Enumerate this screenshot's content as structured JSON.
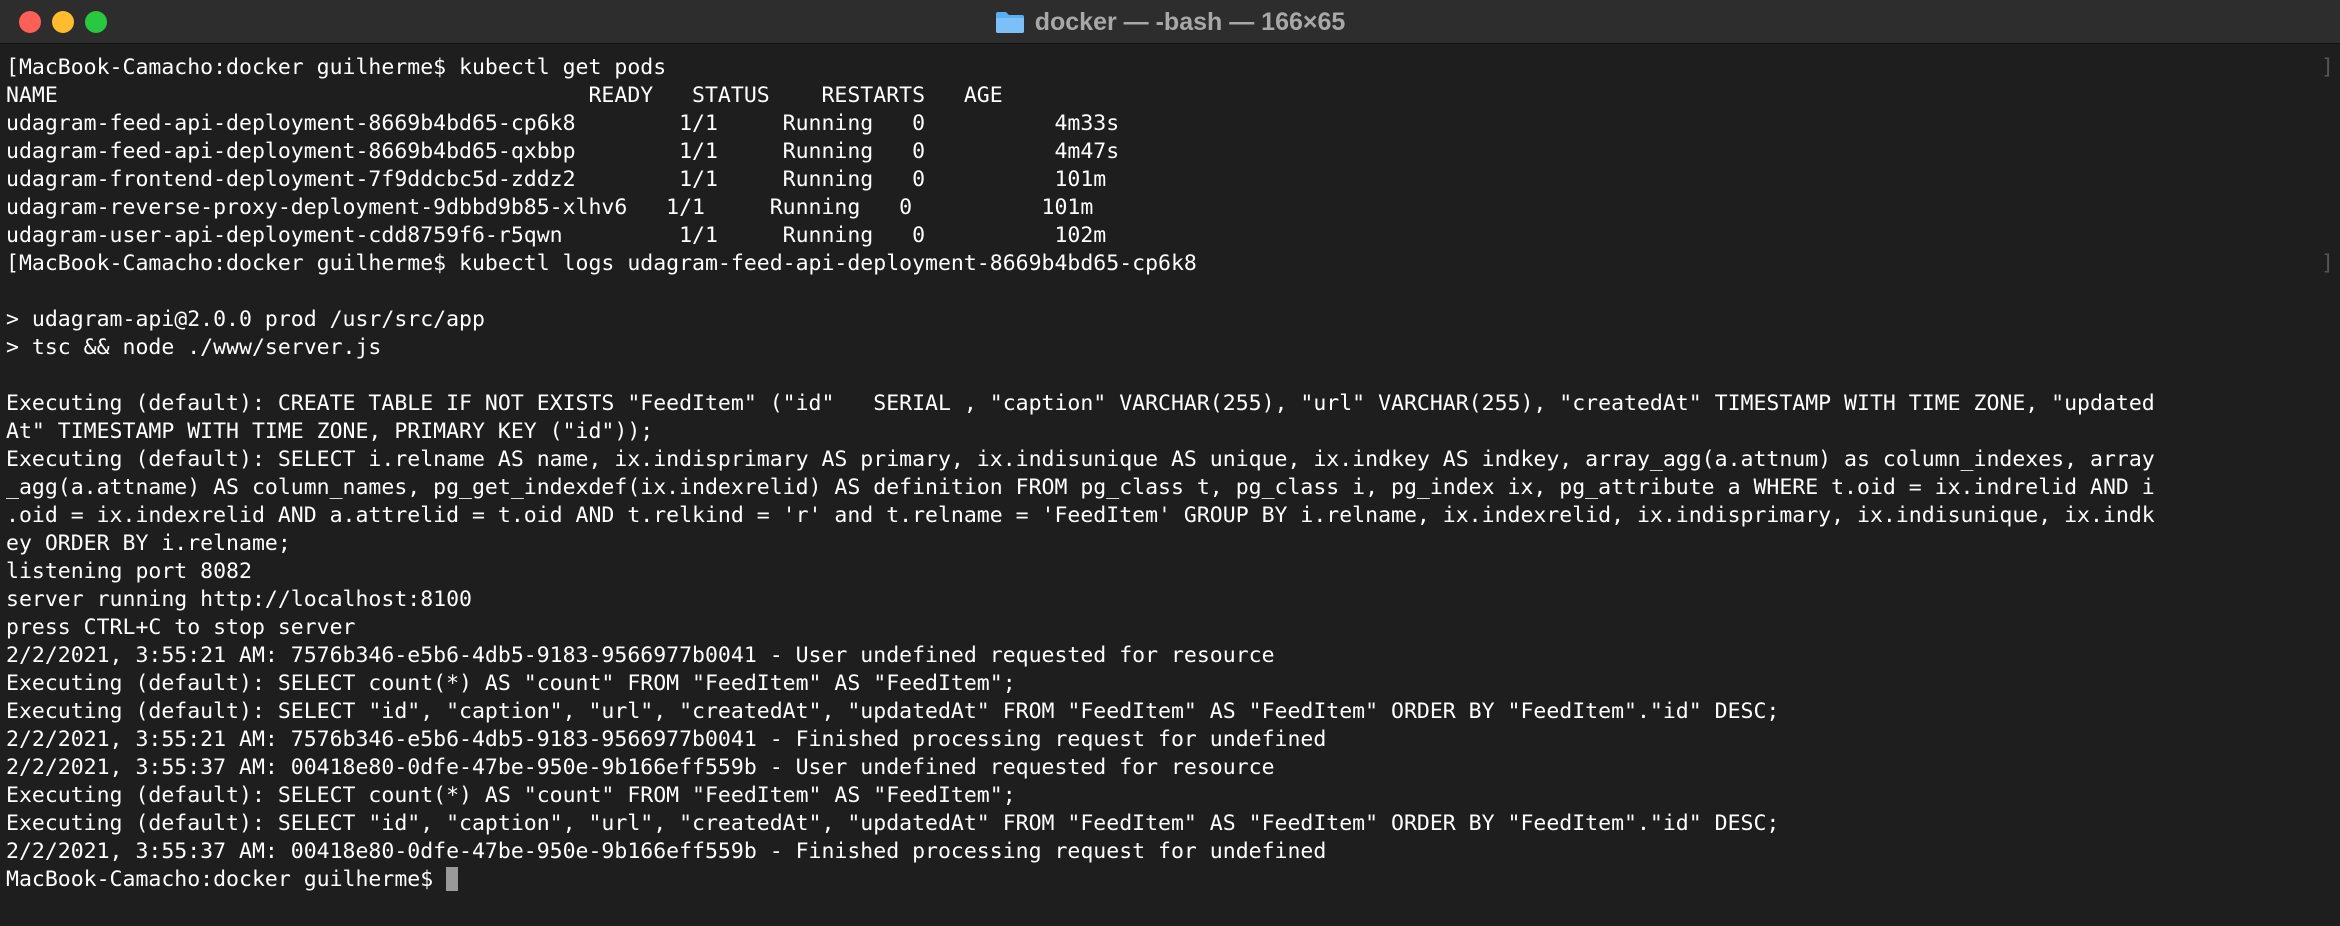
{
  "window": {
    "title": "docker — -bash — 166×65",
    "title_icon": "folder-icon"
  },
  "terminal": {
    "lines": [
      "[MacBook-Camacho:docker guilherme$ kubectl get pods",
      "NAME                                         READY   STATUS    RESTARTS   AGE",
      "udagram-feed-api-deployment-8669b4bd65-cp6k8        1/1     Running   0          4m33s",
      "udagram-feed-api-deployment-8669b4bd65-qxbbp        1/1     Running   0          4m47s",
      "udagram-frontend-deployment-7f9ddcbc5d-zddz2        1/1     Running   0          101m",
      "udagram-reverse-proxy-deployment-9dbbd9b85-xlhv6   1/1     Running   0          101m",
      "udagram-user-api-deployment-cdd8759f6-r5qwn         1/1     Running   0          102m",
      "[MacBook-Camacho:docker guilherme$ kubectl logs udagram-feed-api-deployment-8669b4bd65-cp6k8",
      "",
      "> udagram-api@2.0.0 prod /usr/src/app",
      "> tsc && node ./www/server.js",
      "",
      "Executing (default): CREATE TABLE IF NOT EXISTS \"FeedItem\" (\"id\"   SERIAL , \"caption\" VARCHAR(255), \"url\" VARCHAR(255), \"createdAt\" TIMESTAMP WITH TIME ZONE, \"updated",
      "At\" TIMESTAMP WITH TIME ZONE, PRIMARY KEY (\"id\"));",
      "Executing (default): SELECT i.relname AS name, ix.indisprimary AS primary, ix.indisunique AS unique, ix.indkey AS indkey, array_agg(a.attnum) as column_indexes, array",
      "_agg(a.attname) AS column_names, pg_get_indexdef(ix.indexrelid) AS definition FROM pg_class t, pg_class i, pg_index ix, pg_attribute a WHERE t.oid = ix.indrelid AND i",
      ".oid = ix.indexrelid AND a.attrelid = t.oid AND t.relkind = 'r' and t.relname = 'FeedItem' GROUP BY i.relname, ix.indexrelid, ix.indisprimary, ix.indisunique, ix.indk",
      "ey ORDER BY i.relname;",
      "listening port 8082",
      "server running http://localhost:8100",
      "press CTRL+C to stop server",
      "2/2/2021, 3:55:21 AM: 7576b346-e5b6-4db5-9183-9566977b0041 - User undefined requested for resource",
      "Executing (default): SELECT count(*) AS \"count\" FROM \"FeedItem\" AS \"FeedItem\";",
      "Executing (default): SELECT \"id\", \"caption\", \"url\", \"createdAt\", \"updatedAt\" FROM \"FeedItem\" AS \"FeedItem\" ORDER BY \"FeedItem\".\"id\" DESC;",
      "2/2/2021, 3:55:21 AM: 7576b346-e5b6-4db5-9183-9566977b0041 - Finished processing request for undefined",
      "2/2/2021, 3:55:37 AM: 00418e80-0dfe-47be-950e-9b166eff559b - User undefined requested for resource",
      "Executing (default): SELECT count(*) AS \"count\" FROM \"FeedItem\" AS \"FeedItem\";",
      "Executing (default): SELECT \"id\", \"caption\", \"url\", \"createdAt\", \"updatedAt\" FROM \"FeedItem\" AS \"FeedItem\" ORDER BY \"FeedItem\".\"id\" DESC;",
      "2/2/2021, 3:55:37 AM: 00418e80-0dfe-47be-950e-9b166eff559b - Finished processing request for undefined"
    ],
    "prompt": "MacBook-Camacho:docker guilherme$ ",
    "right_bracket": "]"
  },
  "colors": {
    "close": "#fe5f57",
    "minimize": "#febc2e",
    "maximize": "#28c840",
    "background": "#1e1e1e",
    "text": "#ffffff"
  }
}
